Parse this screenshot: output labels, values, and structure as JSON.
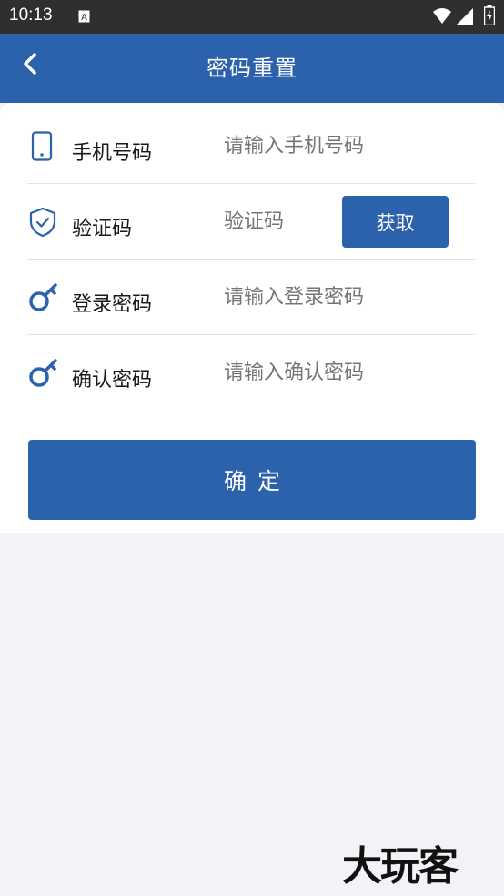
{
  "status_bar": {
    "time": "10:13"
  },
  "app_bar": {
    "title": "密码重置"
  },
  "form": {
    "phone": {
      "label": "手机号码",
      "placeholder": "请输入手机号码"
    },
    "code": {
      "label": "验证码",
      "placeholder": "验证码",
      "button": "获取"
    },
    "login_password": {
      "label": "登录密码",
      "placeholder": "请输入登录密码"
    },
    "confirm_password": {
      "label": "确认密码",
      "placeholder": "请输入确认密码"
    },
    "submit": "确定"
  },
  "watermark": "大玩客",
  "icons": {
    "back": "chevron-left-icon",
    "phone": "phone-icon",
    "shield": "shield-check-icon",
    "key": "key-icon"
  },
  "colors": {
    "primary": "#2c62ac",
    "background": "#f2f2f7",
    "statusbar": "#2f2f2f"
  }
}
